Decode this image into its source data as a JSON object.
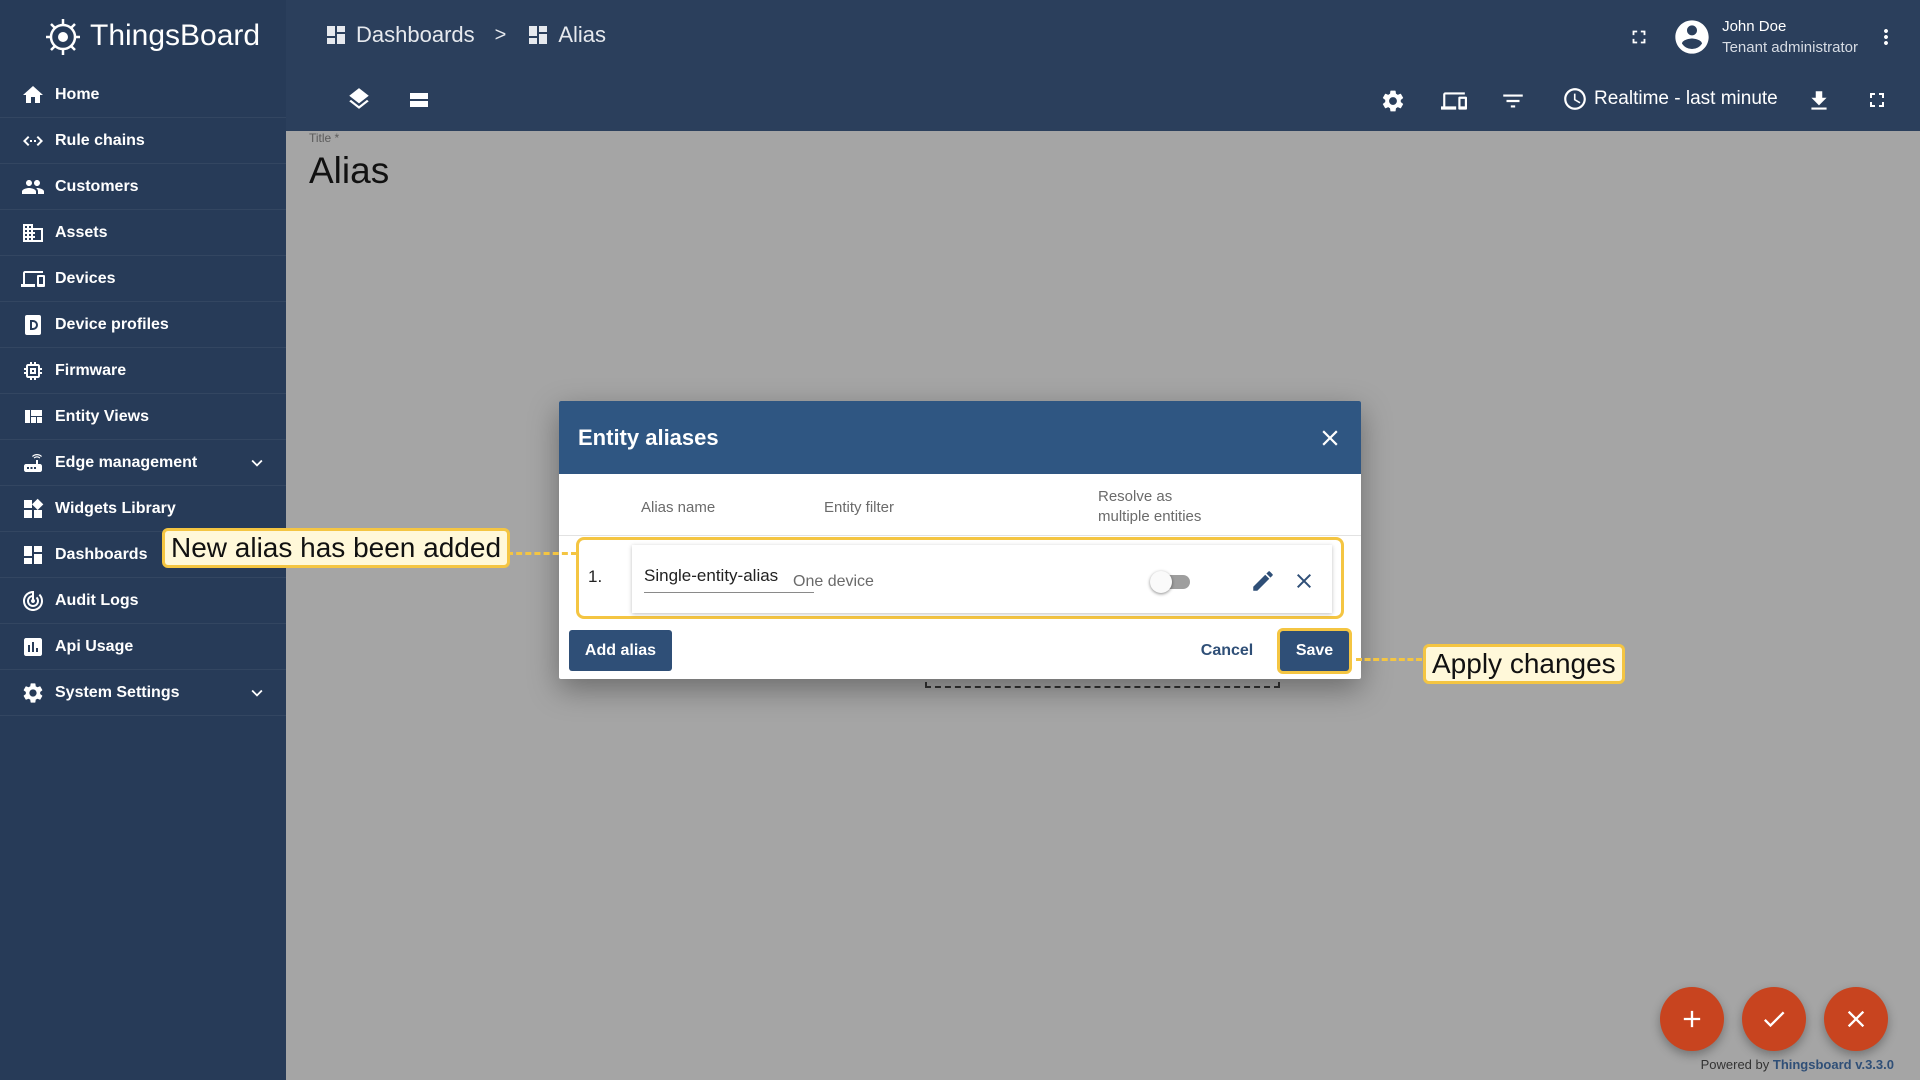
{
  "app": {
    "name": "ThingsBoard"
  },
  "sidebar": {
    "items": [
      {
        "label": "Home",
        "icon": "home-icon"
      },
      {
        "label": "Rule chains",
        "icon": "rule-chain-icon"
      },
      {
        "label": "Customers",
        "icon": "people-icon"
      },
      {
        "label": "Assets",
        "icon": "building-icon"
      },
      {
        "label": "Devices",
        "icon": "devices-icon"
      },
      {
        "label": "Device profiles",
        "icon": "device-profile-icon"
      },
      {
        "label": "Firmware",
        "icon": "chip-icon"
      },
      {
        "label": "Entity Views",
        "icon": "view-quilt-icon"
      },
      {
        "label": "Edge management",
        "icon": "router-icon",
        "expandable": true
      },
      {
        "label": "Widgets Library",
        "icon": "widgets-icon"
      },
      {
        "label": "Dashboards",
        "icon": "dashboard-icon"
      },
      {
        "label": "Audit Logs",
        "icon": "track-changes-icon"
      },
      {
        "label": "Api Usage",
        "icon": "insert-chart-icon"
      },
      {
        "label": "System Settings",
        "icon": "gear-icon",
        "expandable": true
      }
    ]
  },
  "header": {
    "breadcrumb": [
      {
        "label": "Dashboards",
        "icon": "dashboard-icon"
      },
      {
        "label": "Alias",
        "icon": "dashboard-icon"
      }
    ],
    "separator": ">",
    "user": {
      "name": "John Doe",
      "role": "Tenant administrator"
    },
    "timewindow": "Realtime - last minute"
  },
  "main": {
    "title_label": "Title *",
    "title_value": "Alias"
  },
  "dialog": {
    "title": "Entity aliases",
    "columns": {
      "alias_name": "Alias name",
      "entity_filter": "Entity filter",
      "resolve_line1": "Resolve as",
      "resolve_line2": "multiple entities"
    },
    "rows": [
      {
        "index": "1.",
        "alias_name": "Single-entity-alias",
        "entity_filter": "One device",
        "resolve_multiple": false
      }
    ],
    "add_label": "Add alias",
    "cancel_label": "Cancel",
    "save_label": "Save"
  },
  "callouts": {
    "new_alias": "New alias has been added",
    "apply": "Apply changes"
  },
  "footer": {
    "powered_prefix": "Powered by",
    "powered_link": "Thingsboard v.3.3.0"
  },
  "colors": {
    "sidebar": "#273b58",
    "header": "#2b3f5c",
    "dialog_header": "#2f5682",
    "primary_button": "#2f4f77",
    "highlight": "#f4c542",
    "fab": "#c8441f"
  }
}
